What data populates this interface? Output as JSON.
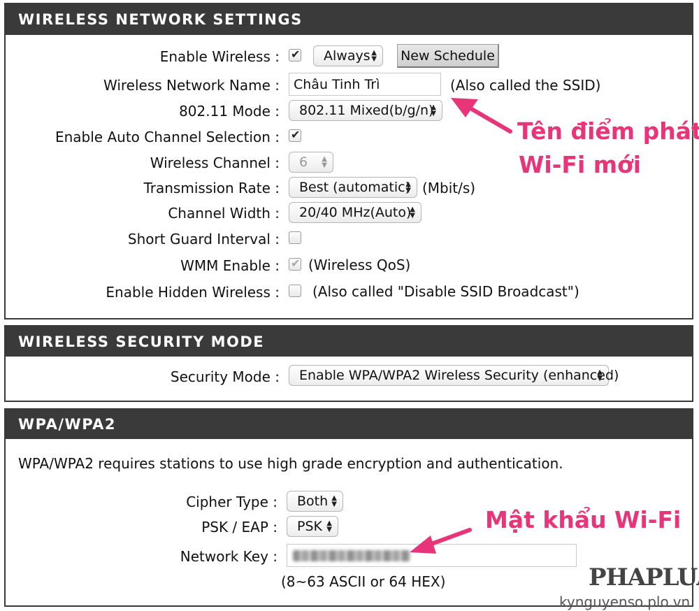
{
  "wireless": {
    "header": "WIRELESS NETWORK SETTINGS",
    "enable_wireless_label": "Enable Wireless :",
    "schedule_value": "Always",
    "new_schedule_label": "New Schedule",
    "network_name_label": "Wireless Network Name :",
    "network_name_value": "Châu Tinh Trì",
    "ssid_note": "(Also called the SSID)",
    "mode_label": "802.11 Mode :",
    "mode_value": "802.11 Mixed(b/g/n)",
    "auto_channel_label": "Enable Auto Channel Selection :",
    "channel_label": "Wireless Channel :",
    "channel_value": "6",
    "rate_label": "Transmission Rate :",
    "rate_value": "Best (automatic)",
    "rate_unit": "(Mbit/s)",
    "width_label": "Channel Width :",
    "width_value": "20/40 MHz(Auto)",
    "guard_label": "Short Guard Interval :",
    "wmm_label": "WMM Enable :",
    "wmm_note": "(Wireless QoS)",
    "hidden_label": "Enable Hidden Wireless :",
    "hidden_note": "(Also called \"Disable SSID Broadcast\")"
  },
  "security": {
    "header": "WIRELESS SECURITY MODE",
    "mode_label": "Security Mode :",
    "mode_value": "Enable WPA/WPA2 Wireless Security (enhanced)"
  },
  "wpa": {
    "header": "WPA/WPA2",
    "description": "WPA/WPA2 requires stations to use high grade encryption and authentication.",
    "cipher_label": "Cipher Type :",
    "cipher_value": "Both",
    "psk_label": "PSK / EAP :",
    "psk_value": "PSK",
    "key_label": "Network Key :",
    "key_hint": "(8~63 ASCII or 64 HEX)"
  },
  "annotations": {
    "ssid_callout_line1": "Tên điểm phát",
    "ssid_callout_line2": "Wi-Fi mới",
    "password_callout": "Mật khẩu Wi-Fi",
    "color": "#e8357a"
  },
  "watermark": {
    "logo": "PHAPLUAT",
    "site": "kynguyenso.plo.vn"
  }
}
